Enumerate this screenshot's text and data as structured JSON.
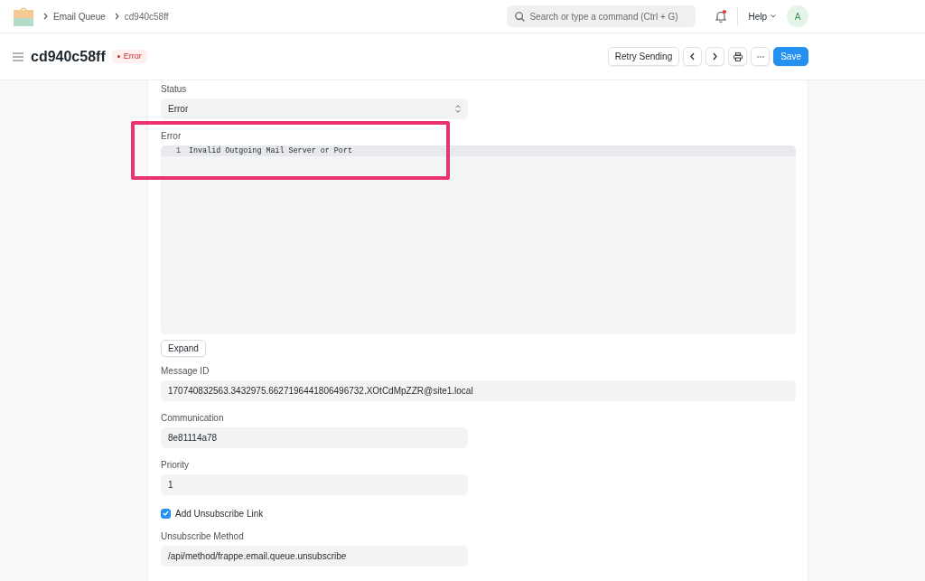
{
  "navbar": {
    "breadcrumbs": [
      "Email Queue",
      "cd940c58ff"
    ],
    "search": {
      "placeholder": "Search or type a command (Ctrl + G)"
    },
    "notifications": {
      "unread": true
    },
    "help": {
      "label": "Help"
    },
    "avatar": {
      "initial": "A"
    }
  },
  "page_head": {
    "title": "cd940c58ff",
    "status": {
      "label": "Error"
    },
    "actions": [
      {
        "kind": "text",
        "label": "Retry Sending"
      },
      {
        "kind": "previous"
      },
      {
        "kind": "next"
      },
      {
        "kind": "print"
      },
      {
        "kind": "more"
      },
      {
        "kind": "primary",
        "label": "Save"
      }
    ]
  },
  "form": {
    "fields": [
      {
        "kind": "select",
        "label": "Status",
        "value": "Error"
      },
      {
        "kind": "code",
        "label": "Error",
        "highlighted": true,
        "lines": [
          {
            "number": "1",
            "text": "Invalid Outgoing Mail Server or Port",
            "active": true
          }
        ],
        "button": "Expand"
      },
      {
        "kind": "small-text",
        "label": "Message ID",
        "value": "170740832563.3432975.6627196441806496732.XOtCdMpZZR@site1.local"
      },
      {
        "kind": "data",
        "label": "Communication",
        "value": "8e81114a78"
      },
      {
        "kind": "data",
        "label": "Priority",
        "value": "1"
      },
      {
        "kind": "check",
        "label": "Add Unsubscribe Link",
        "checked": true
      },
      {
        "kind": "data",
        "label": "Unsubscribe Method",
        "value": "/api/method/frappe.email.queue.unsubscribe"
      }
    ]
  }
}
